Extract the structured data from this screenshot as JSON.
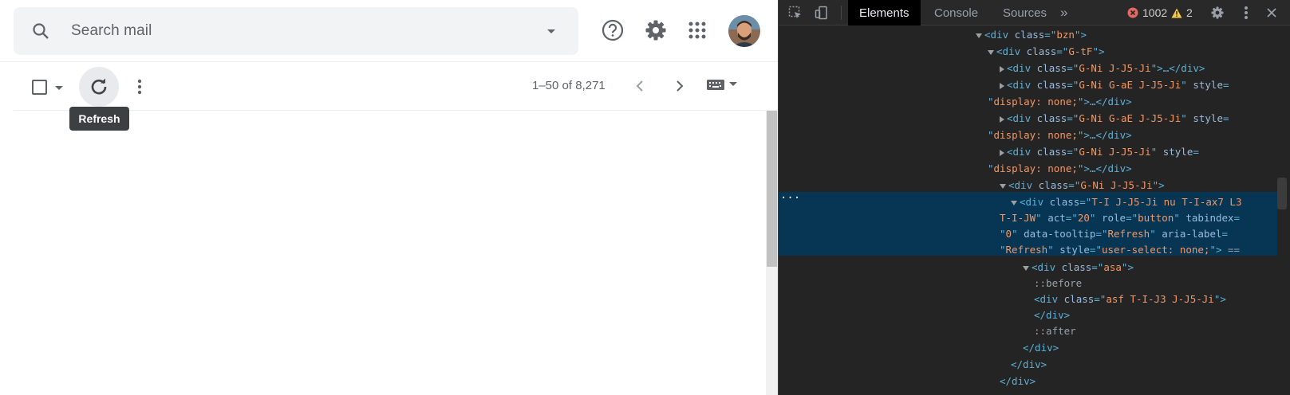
{
  "gmail": {
    "search": {
      "placeholder": "Search mail"
    },
    "toolbar": {
      "pagination": "1–50 of 8,271",
      "tooltip": "Refresh"
    }
  },
  "devtools": {
    "tabs": [
      {
        "label": "Elements",
        "active": true
      },
      {
        "label": "Console",
        "active": false
      },
      {
        "label": "Sources",
        "active": false
      }
    ],
    "more_tabs": "»",
    "errors": "1002",
    "warnings": "2",
    "dom_tree": {
      "l1": {
        "tag": "div",
        "attr": "class",
        "val": "bzn"
      },
      "l2": {
        "tag": "div",
        "attr": "class",
        "val": "G-tF"
      },
      "l3": {
        "tag": "div",
        "attr": "class",
        "val": "G-Ni J-J5-Ji",
        "collapsed": "…</div>"
      },
      "l4": {
        "tag": "div",
        "attr": "class",
        "val": "G-Ni G-aE J-J5-Ji",
        "style_attr": "style",
        "style_val": "display: none;",
        "collapsed": "…</div>"
      },
      "l5": {
        "tag": "div",
        "attr": "class",
        "val": "G-Ni G-aE J-J5-Ji",
        "style_attr": "style",
        "style_val": "display: none;",
        "collapsed": "…</div>"
      },
      "l6": {
        "tag": "div",
        "attr": "class",
        "val": "G-Ni J-J5-Ji",
        "style_attr": "style",
        "style_val": "display: none;",
        "collapsed": "…</div>"
      },
      "l7": {
        "tag": "div",
        "attr": "class",
        "val": "G-Ni J-J5-Ji"
      },
      "selected": {
        "tag": "div",
        "class_val": "T-I J-J5-Ji nu T-I-ax7 L3",
        "class_val2": "T-I-JW",
        "act": "20",
        "role": "button",
        "tabindex": "0",
        "tooltip": "Refresh",
        "aria_label": "Refresh",
        "style": "user-select: none;",
        "suffix": "=="
      },
      "l8": {
        "tag": "div",
        "attr": "class",
        "val": "asa"
      },
      "before": "::before",
      "l9": {
        "tag": "div",
        "attr": "class",
        "val": "asf T-I-J3 J-J5-Ji"
      },
      "close": "</div>",
      "after": "::after"
    }
  }
}
